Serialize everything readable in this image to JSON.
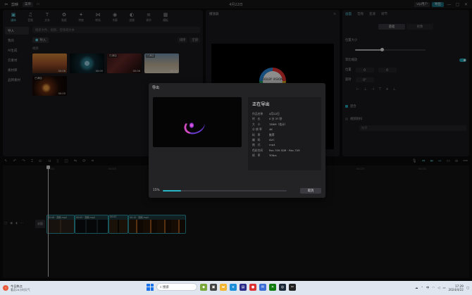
{
  "titlebar": {
    "app_name": "剪映",
    "menu_label": "菜单",
    "project_title": "4月22日",
    "user_label": "vip用户",
    "export_label": "导出",
    "min": "—",
    "max": "▢",
    "close": "✕"
  },
  "toolbar": {
    "items": [
      {
        "icon": "▣",
        "label": "媒体"
      },
      {
        "icon": "♫",
        "label": "音频"
      },
      {
        "icon": "T",
        "label": "文本"
      },
      {
        "icon": "✿",
        "label": "贴纸"
      },
      {
        "icon": "✦",
        "label": "特效"
      },
      {
        "icon": "⋈",
        "label": "转场"
      },
      {
        "icon": "◉",
        "label": "字幕"
      },
      {
        "icon": "◐",
        "label": "滤镜"
      },
      {
        "icon": "≡",
        "label": "调节"
      },
      {
        "icon": "▦",
        "label": "模板"
      }
    ]
  },
  "media_sidebar": {
    "items": [
      "导入",
      "我的",
      "AI生成",
      "云素材",
      "素材库",
      "品牌素材"
    ]
  },
  "media": {
    "search_placeholder": "搜索文件、视频、音频或文本",
    "import_label": "导入",
    "sort_label": "排序",
    "filter_label": "全部",
    "section_label": "视频",
    "thumbs": [
      {
        "title": "",
        "duration": "00:08"
      },
      {
        "title": "",
        "duration": "00:05"
      },
      {
        "title": "已添加",
        "duration": "00:06"
      },
      {
        "title": "已添加",
        "duration": "00:10"
      },
      {
        "title": "已添加",
        "duration": "00:05"
      }
    ]
  },
  "player": {
    "title": "播放器",
    "dolby_text": "DOLBY VISION"
  },
  "props": {
    "tabs": [
      "画面",
      "音频",
      "变速",
      "调节"
    ],
    "subtabs": [
      "基础",
      "抠像"
    ],
    "scale_label": "位置大小",
    "ratio_label": "等比缩放",
    "pos_label": "位置",
    "pos_x": "0",
    "pos_y": "0",
    "rotate_label": "旋转",
    "rotate_val": "0°",
    "blend_label": "混合",
    "stabilize_label": "视频防抖",
    "dim_input": "推荐"
  },
  "timeline": {
    "ruler": [
      "00:00",
      "00:05",
      "00:10",
      "00:15",
      "00:20",
      "00:25",
      "00:30",
      "00:35"
    ],
    "cover_label": "封面",
    "clips": [
      {
        "label": "00:08 · 视频.mp4"
      },
      {
        "label": "00:05 · 视频.mp4"
      },
      {
        "label": "00:03"
      },
      {
        "label": "00:10 · 视频.mp4"
      }
    ]
  },
  "export_modal": {
    "title": "导出",
    "heading": "正在导出",
    "rows": [
      {
        "k": "作品名称",
        "v": "4月22日"
      },
      {
        "k": "时　长",
        "v": "0 分 37 秒"
      },
      {
        "k": "大　小",
        "v": "789M（估计）"
      },
      {
        "k": "分 辨 率",
        "v": "4K"
      },
      {
        "k": "码　率",
        "v": "推荐"
      },
      {
        "k": "编　码",
        "v": "AVC"
      },
      {
        "k": "格　式",
        "v": "mp4"
      },
      {
        "k": "色彩空间",
        "v": "Rec.709 SDR · Rec.709"
      },
      {
        "k": "帧　率",
        "v": "30fps"
      }
    ],
    "progress_text": "15%",
    "progress": 0.15,
    "cancel_label": "取消"
  },
  "taskbar": {
    "weather_title": "今日热点",
    "weather_sub": "看点24小时天气",
    "search_placeholder": "搜索",
    "time": "17:29",
    "date": "2024/4/22",
    "lang": "中"
  },
  "colors": {
    "accent": "#1fa8b9",
    "panel": "#1b1b1e",
    "background": "#0b0b0c"
  }
}
